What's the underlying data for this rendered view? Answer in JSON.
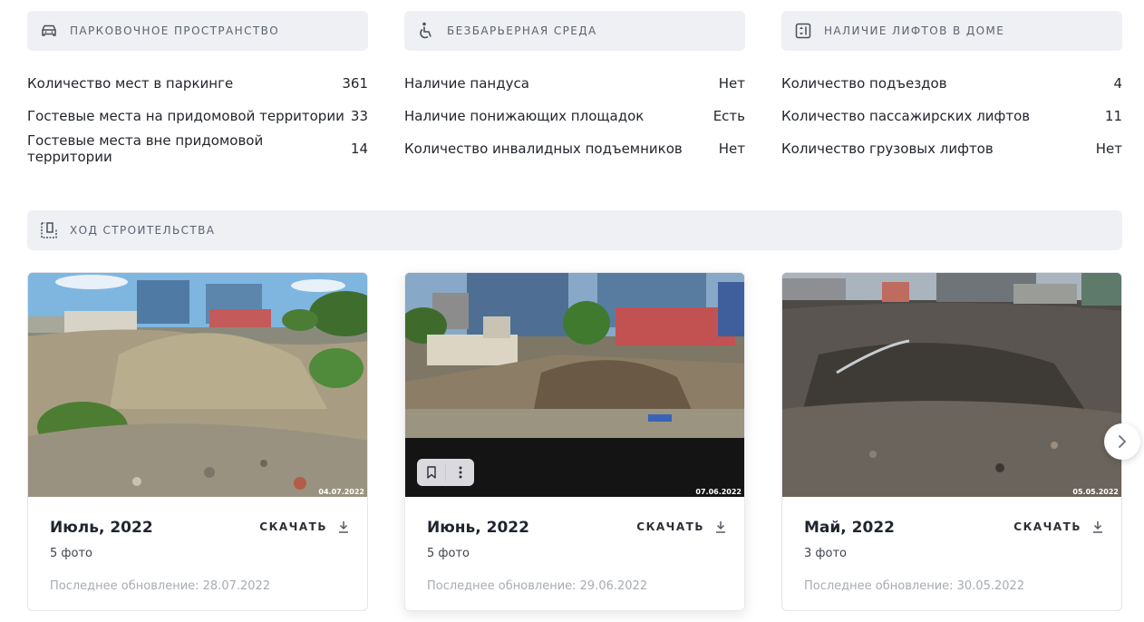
{
  "sections": {
    "parking": {
      "title": "ПАРКОВОЧНОЕ ПРОСТРАНСТВО",
      "icon": "car-icon",
      "rows": [
        {
          "label": "Количество мест в паркинге",
          "value": "361"
        },
        {
          "label": "Гостевые места на придомовой территории",
          "value": "33"
        },
        {
          "label": "Гостевые места вне придомовой территории",
          "value": "14"
        }
      ]
    },
    "accessibility": {
      "title": "БЕЗБАРЬЕРНАЯ СРЕДА",
      "icon": "wheelchair-icon",
      "rows": [
        {
          "label": "Наличие пандуса",
          "value": "Нет"
        },
        {
          "label": "Наличие понижающих площадок",
          "value": "Есть"
        },
        {
          "label": "Количество инвалидных подъемников",
          "value": "Нет"
        }
      ]
    },
    "elevators": {
      "title": "НАЛИЧИЕ ЛИФТОВ В ДОМЕ",
      "icon": "elevator-icon",
      "rows": [
        {
          "label": "Количество подъездов",
          "value": "4"
        },
        {
          "label": "Количество пассажирских лифтов",
          "value": "11"
        },
        {
          "label": "Количество грузовых лифтов",
          "value": "Нет"
        }
      ]
    },
    "construction": {
      "title": "ХОД СТРОИТЕЛЬСТВА",
      "icon": "construction-icon"
    }
  },
  "cards": [
    {
      "title": "Июль, 2022",
      "count": "5 фото",
      "updated": "Последнее обновление: 28.07.2022",
      "photo_date": "04.07.2022",
      "download_label": "СКАЧАТЬ"
    },
    {
      "title": "Июнь, 2022",
      "count": "5 фото",
      "updated": "Последнее обновление: 29.06.2022",
      "photo_date": "07.06.2022",
      "download_label": "СКАЧАТЬ"
    },
    {
      "title": "Май, 2022",
      "count": "3 фото",
      "updated": "Последнее обновление: 30.05.2022",
      "photo_date": "05.05.2022",
      "download_label": "СКАЧАТЬ"
    }
  ],
  "colors": {
    "header_bg": "#eef0f4",
    "header_text": "#5d6272",
    "muted_text": "#a7abb4"
  }
}
